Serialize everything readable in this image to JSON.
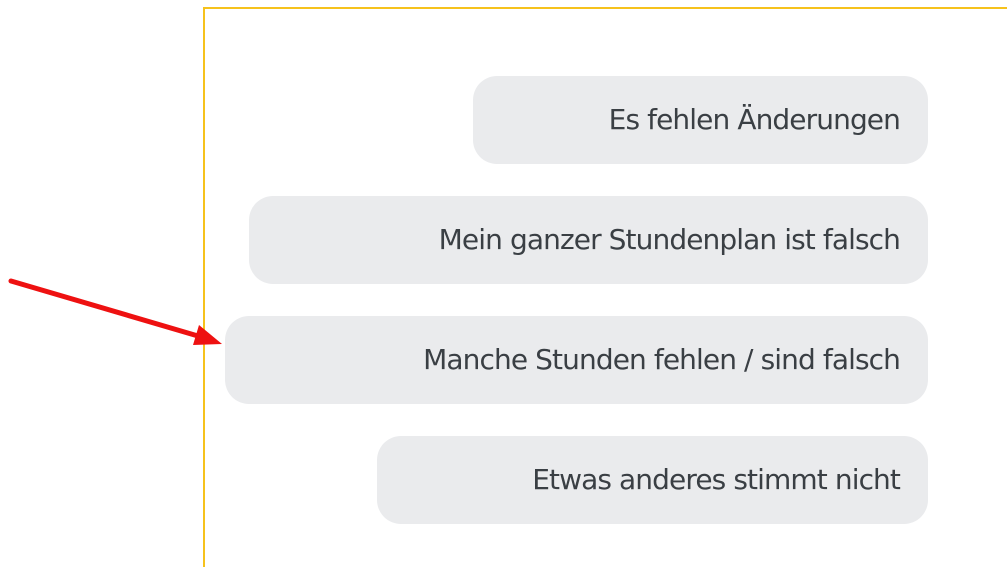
{
  "options": [
    {
      "label": "Es fehlen Änderungen"
    },
    {
      "label": "Mein ganzer Stundenplan ist falsch"
    },
    {
      "label": "Manche Stunden fehlen / sind falsch"
    },
    {
      "label": "Etwas anderes stimmt nicht"
    }
  ],
  "colors": {
    "panel_border": "#f6c21c",
    "chip_background": "#eaebed",
    "chip_text": "#3a3f44",
    "annotation_arrow": "#ee1111"
  },
  "annotation": {
    "icon": "red-arrow-icon",
    "points_to_option": 3
  }
}
